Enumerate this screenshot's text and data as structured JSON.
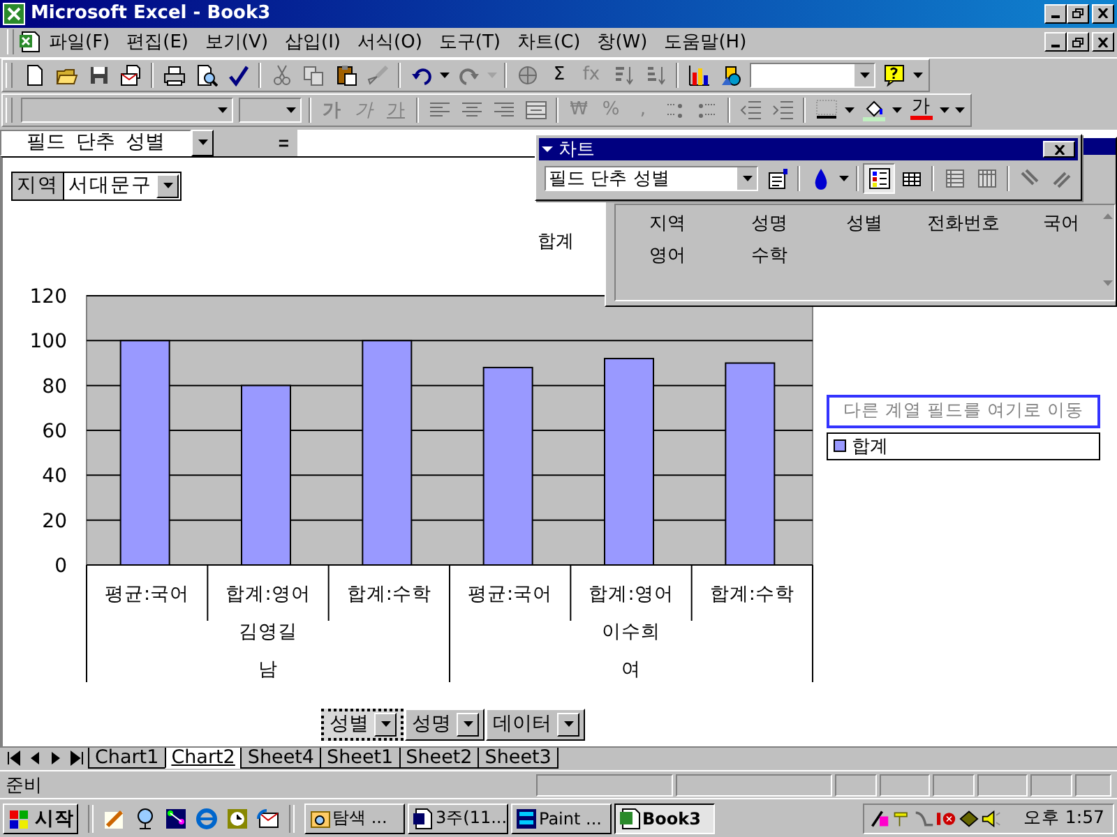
{
  "window": {
    "title": "Microsoft Excel - Book3"
  },
  "menu": {
    "items": [
      "파일(F)",
      "편집(E)",
      "보기(V)",
      "삽입(I)",
      "서식(O)",
      "도구(T)",
      "차트(C)",
      "창(W)",
      "도움말(H)"
    ]
  },
  "toolbars": [
    {
      "items": [
        {
          "kind": "button",
          "disabled": false
        },
        {
          "kind": "button",
          "disabled": false
        },
        {
          "kind": "button",
          "disabled": false
        },
        {
          "kind": "button",
          "disabled": false
        },
        {
          "kind": "separator"
        },
        {
          "kind": "button",
          "disabled": false
        },
        {
          "kind": "button",
          "disabled": false
        },
        {
          "kind": "button",
          "disabled": false
        },
        {
          "kind": "separator"
        },
        {
          "kind": "button",
          "disabled": true
        },
        {
          "kind": "button",
          "disabled": true
        },
        {
          "kind": "button",
          "disabled": false
        },
        {
          "kind": "button",
          "disabled": true
        },
        {
          "kind": "separator"
        },
        {
          "kind": "button",
          "disabled": false
        },
        {
          "kind": "dropdown",
          "disabled": false
        },
        {
          "kind": "button",
          "disabled": true
        },
        {
          "kind": "dropdown",
          "disabled": true
        },
        {
          "kind": "separator"
        },
        {
          "kind": "button",
          "disabled": true
        },
        {
          "kind": "text",
          "label": "Σ",
          "disabled": false
        },
        {
          "kind": "text",
          "label": "fx",
          "disabled": true
        },
        {
          "kind": "button",
          "disabled": true
        },
        {
          "kind": "button",
          "disabled": true
        },
        {
          "kind": "separator"
        },
        {
          "kind": "button",
          "disabled": false
        },
        {
          "kind": "button",
          "disabled": false
        },
        {
          "kind": "combo",
          "disabled": false
        },
        {
          "kind": "button",
          "disabled": false
        },
        {
          "kind": "dropdown",
          "disabled": false
        }
      ]
    },
    {
      "items": [
        {
          "kind": "combo",
          "disabled": true
        },
        {
          "kind": "combo",
          "disabled": true
        },
        {
          "kind": "separator"
        },
        {
          "kind": "bold",
          "label": "가",
          "disabled": true
        },
        {
          "kind": "italic",
          "label": "가",
          "disabled": true
        },
        {
          "kind": "underline",
          "label": "가",
          "disabled": true
        },
        {
          "kind": "separator"
        },
        {
          "kind": "button",
          "disabled": true
        },
        {
          "kind": "button",
          "disabled": true
        },
        {
          "kind": "button",
          "disabled": true
        },
        {
          "kind": "button",
          "disabled": true
        },
        {
          "kind": "separator"
        },
        {
          "kind": "text",
          "label": "₩",
          "disabled": true
        },
        {
          "kind": "text",
          "label": "%",
          "disabled": true
        },
        {
          "kind": "text",
          "label": ",",
          "disabled": true
        },
        {
          "kind": "button",
          "disabled": true
        },
        {
          "kind": "button",
          "disabled": true
        },
        {
          "kind": "separator"
        },
        {
          "kind": "button",
          "disabled": true
        },
        {
          "kind": "button",
          "disabled": true
        },
        {
          "kind": "separator"
        },
        {
          "kind": "button",
          "disabled": false
        },
        {
          "kind": "dropdown",
          "disabled": false
        },
        {
          "kind": "button",
          "disabled": false
        },
        {
          "kind": "dropdown",
          "disabled": false
        },
        {
          "kind": "fontcolor",
          "label": "가",
          "disabled": false
        },
        {
          "kind": "dropdown",
          "disabled": false
        },
        {
          "kind": "dropdown",
          "disabled": false
        }
      ]
    }
  ],
  "formula_bar": {
    "name_box": "필드 단추 성별",
    "equals": "="
  },
  "page_field": {
    "label": "지역",
    "value": "서대문구"
  },
  "chart": {
    "chart_data": {
      "type": "bar",
      "title": "합계",
      "categories": [
        "평균:국어",
        "합계:영어",
        "합계:수학",
        "평균:국어",
        "합계:영어",
        "합계:수학"
      ],
      "series": [
        {
          "name": "합계",
          "color": "#9999ff",
          "values": [
            100,
            80,
            100,
            88,
            92,
            90
          ]
        }
      ],
      "ylim": [
        0,
        120
      ],
      "yticks": [
        0,
        20,
        40,
        60,
        80,
        100,
        120
      ],
      "grid": true
    },
    "category_groups": [
      {
        "name": "김영길",
        "sub": "남"
      },
      {
        "name": "이수희",
        "sub": "여"
      }
    ]
  },
  "series_drop_zone": "다른 계열 필드를 여기로 이동",
  "row_fields": [
    {
      "label": "성별",
      "selected": true
    },
    {
      "label": "성명",
      "selected": false
    },
    {
      "label": "데이터",
      "selected": false
    }
  ],
  "chart_toolbar": {
    "title": "차트",
    "items": [
      {
        "kind": "combo",
        "value": "필드 단추 성별",
        "disabled": false
      },
      {
        "kind": "button",
        "disabled": false
      },
      {
        "kind": "separator"
      },
      {
        "kind": "button",
        "disabled": false
      },
      {
        "kind": "dropdown",
        "disabled": false
      },
      {
        "kind": "separator"
      },
      {
        "kind": "button",
        "disabled": false,
        "on": true
      },
      {
        "kind": "button",
        "disabled": false,
        "on": false
      },
      {
        "kind": "separator"
      },
      {
        "kind": "button",
        "disabled": true
      },
      {
        "kind": "button",
        "disabled": true
      },
      {
        "kind": "separator"
      },
      {
        "kind": "button",
        "disabled": true
      },
      {
        "kind": "button",
        "disabled": true
      }
    ]
  },
  "field_list": {
    "fields": [
      "지역",
      "성명",
      "성별",
      "전화번호",
      "국어",
      "영어",
      "수학"
    ]
  },
  "sheet_tabs": [
    {
      "label": "Chart1",
      "selected": false
    },
    {
      "label": "Chart2",
      "selected": true
    },
    {
      "label": "Sheet4",
      "selected": false
    },
    {
      "label": "Sheet1",
      "selected": false
    },
    {
      "label": "Sheet2",
      "selected": false
    },
    {
      "label": "Sheet3",
      "selected": false
    }
  ],
  "status_bar": {
    "text": "준비"
  },
  "taskbar": {
    "start": "시작",
    "tasks": [
      {
        "label": "탐색 ...",
        "selected": false
      },
      {
        "label": "3주(11...",
        "selected": false
      },
      {
        "label": "Paint ...",
        "selected": false
      },
      {
        "label": "Book3",
        "selected": true
      }
    ],
    "clock": "오후 1:57"
  }
}
